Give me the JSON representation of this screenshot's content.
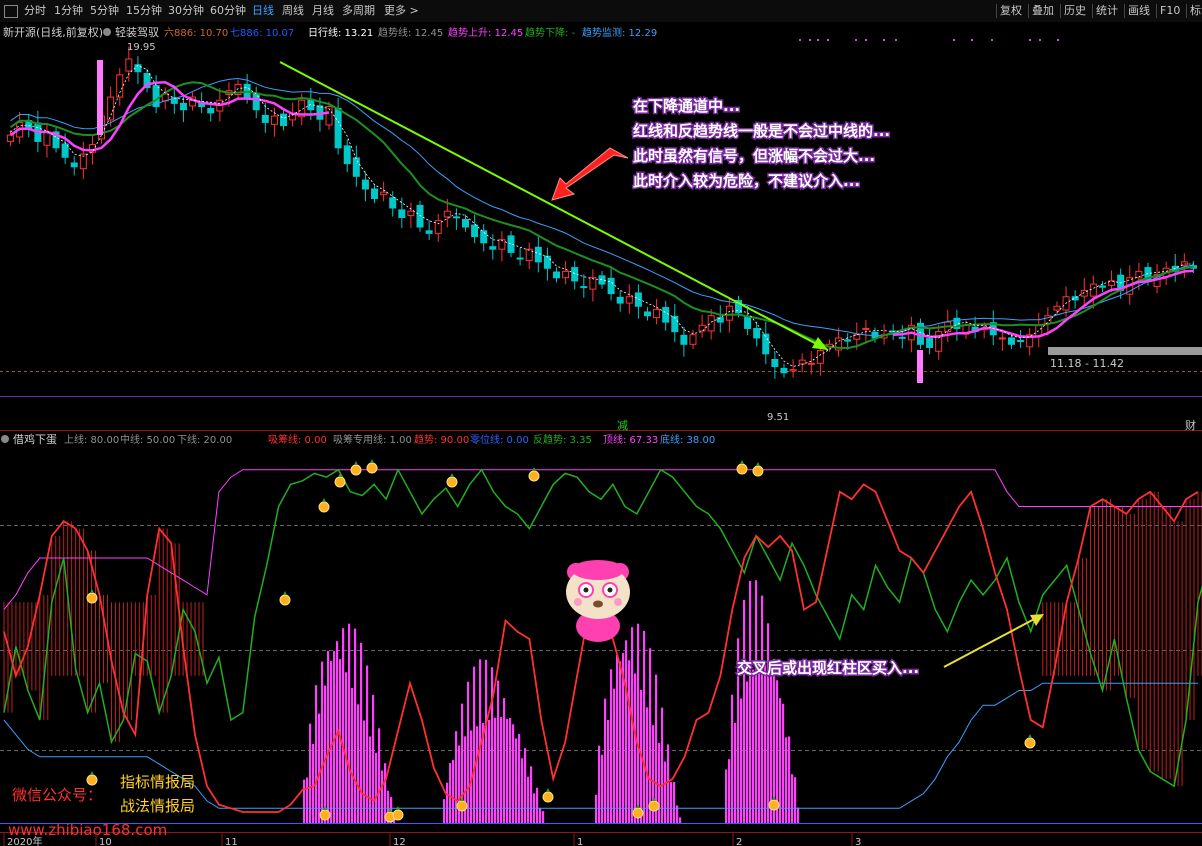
{
  "toolbar": {
    "periods": [
      "分时",
      "1分钟",
      "5分钟",
      "15分钟",
      "30分钟",
      "60分钟",
      "日线",
      "周线",
      "月线",
      "多周期",
      "更多"
    ],
    "active_period": "日线",
    "right_buttons": [
      "复权",
      "叠加",
      "历史",
      "统计",
      "画线",
      "F10",
      "标记"
    ]
  },
  "main_panel": {
    "stock_title": "新开源(日线,前复权)",
    "indicator_name": "轻装驾驭",
    "legend": [
      {
        "label": "六886: 10.70",
        "color": "#d2691e"
      },
      {
        "label": "七886: 10.07",
        "color": "#1e5aff"
      },
      {
        "label": "日行线: 13.21",
        "color": "#ffffff"
      },
      {
        "label": "趋势线: 12.45",
        "color": "#909090"
      },
      {
        "label": "趋势上升: 12.45",
        "color": "#ff40ff"
      },
      {
        "label": "趋势下降: -",
        "color": "#20b020"
      },
      {
        "label": "趋势监测: 12.29",
        "color": "#3aa0ff"
      }
    ],
    "high_label": "19.95",
    "low_label": "9.51",
    "price_tag": "11.18 - 11.42",
    "signal_label": "减",
    "right_edge_label": "财",
    "annotation_lines": [
      "在下降通道中...",
      "红线和反趋势线一般是不会过中线的...",
      "此时虽然有信号，但涨幅不会过大...",
      "此时介入较为危险，不建议介入..."
    ]
  },
  "sub_panel": {
    "indicator_name": "借鸡下蛋",
    "legend": [
      {
        "label": "上线: 80.00",
        "color": "#909090"
      },
      {
        "label": "中线: 50.00",
        "color": "#909090"
      },
      {
        "label": "下线: 20.00",
        "color": "#909090"
      },
      {
        "label": "吸筹线: 0.00",
        "color": "#ff3030"
      },
      {
        "label": "吸筹专用线: 1.00",
        "color": "#909090"
      },
      {
        "label": "趋势: 90.00",
        "color": "#ff3030"
      },
      {
        "label": "零位线: 0.00",
        "color": "#3060ff"
      },
      {
        "label": "反趋势: 3.35",
        "color": "#20b020"
      },
      {
        "label": "顶线: 67.33",
        "color": "#ff40ff"
      },
      {
        "label": "底线: 38.00",
        "color": "#3aa0ff"
      }
    ],
    "annotation": "交叉后或出现红柱区买入..."
  },
  "watermark": {
    "wechat_label": "微信公众号：",
    "line1": "指标情报局",
    "line2": "战法情报局",
    "url": "www.zhibiao168.com"
  },
  "time_axis": [
    "2020年",
    "10",
    "11",
    "12",
    "1",
    "2",
    "3"
  ],
  "colors": {
    "up": "#ff3232",
    "down": "#00c8c8",
    "ma_white": "#e0e0e0",
    "ma_magenta": "#ff40ff",
    "ma_green": "#1f8f1f",
    "ma_blue": "#3aa0ff",
    "trendline": "#7cfc00",
    "arrow_red": "#ff2020",
    "annotation_text": "#ffffff",
    "annotation_bg": "#000000"
  },
  "chart_data": [
    {
      "type": "candlestick",
      "title": "新开源(日线,前复权)",
      "x_labels": [
        "2020年",
        "10",
        "11",
        "12",
        "1",
        "2",
        "3"
      ],
      "ylim": [
        9.0,
        20.2
      ],
      "high": 19.95,
      "low": 9.51,
      "close_series": [
        17.2,
        17.6,
        17.4,
        17.0,
        17.3,
        16.8,
        16.5,
        16.2,
        16.6,
        16.9,
        17.8,
        18.4,
        19.1,
        19.6,
        19.2,
        18.7,
        18.1,
        18.5,
        18.2,
        18.0,
        18.4,
        18.1,
        17.9,
        18.3,
        18.6,
        18.8,
        18.4,
        18.0,
        17.6,
        17.8,
        17.5,
        17.9,
        18.3,
        18.0,
        17.7,
        18.1,
        16.8,
        16.3,
        15.9,
        15.5,
        15.2,
        15.4,
        14.9,
        14.6,
        14.8,
        14.3,
        14.1,
        14.5,
        14.8,
        14.6,
        14.3,
        14.0,
        13.8,
        13.6,
        13.9,
        13.5,
        13.3,
        13.6,
        13.2,
        13.0,
        12.7,
        12.9,
        12.6,
        12.4,
        12.7,
        12.5,
        12.2,
        11.9,
        12.1,
        11.8,
        11.5,
        11.7,
        11.3,
        11.0,
        10.6,
        10.9,
        11.2,
        11.5,
        11.3,
        11.8,
        11.6,
        11.1,
        10.8,
        10.3,
        9.9,
        9.7,
        9.8,
        10.1,
        10.0,
        10.4,
        10.6,
        10.8,
        10.7,
        10.9,
        11.1,
        10.8,
        10.9,
        11.0,
        10.8,
        11.2,
        10.6,
        10.5,
        11.0,
        11.3,
        11.1,
        11.2,
        11.0,
        11.1,
        10.9,
        10.8,
        10.6,
        10.7,
        10.9,
        11.2,
        11.5,
        11.8,
        12.1,
        12.0,
        12.3,
        12.5,
        12.4,
        12.6,
        12.3,
        12.7,
        12.9,
        12.6,
        12.8,
        13.0,
        12.9,
        13.2,
        13.0
      ]
    },
    {
      "type": "line",
      "title": "借鸡下蛋",
      "ylim": [
        0,
        100
      ],
      "reference_lines": [
        80,
        50,
        20
      ],
      "series": [
        {
          "name": "趋势",
          "color": "#ff3030",
          "values": [
            52,
            40,
            48,
            62,
            78,
            82,
            80,
            74,
            62,
            44,
            30,
            24,
            62,
            80,
            76,
            48,
            24,
            10,
            5,
            4,
            3,
            3,
            3,
            3,
            5,
            9,
            10,
            18,
            25,
            14,
            8,
            6,
            12,
            25,
            38,
            28,
            15,
            8,
            6,
            10,
            22,
            35,
            55,
            52,
            50,
            28,
            12,
            22,
            40,
            58,
            55,
            50,
            38,
            22,
            12,
            10,
            12,
            18,
            28,
            30,
            40,
            58,
            72,
            78,
            75,
            78,
            74,
            58,
            60,
            75,
            90,
            88,
            92,
            90,
            82,
            74,
            72,
            68,
            74,
            80,
            86,
            90,
            80,
            68,
            58,
            42,
            28,
            26,
            42,
            60,
            72,
            86,
            88,
            86,
            84,
            88,
            90,
            86,
            82,
            88,
            90
          ]
        },
        {
          "name": "反趋势",
          "color": "#20b020",
          "values": [
            30,
            48,
            36,
            28,
            60,
            72,
            42,
            30,
            38,
            22,
            28,
            46,
            44,
            30,
            40,
            58,
            52,
            38,
            45,
            28,
            30,
            56,
            70,
            86,
            92,
            93,
            95,
            94,
            96,
            90,
            89,
            92,
            88,
            96,
            90,
            84,
            88,
            91,
            86,
            92,
            96,
            90,
            86,
            84,
            80,
            86,
            92,
            95,
            94,
            90,
            88,
            92,
            86,
            84,
            90,
            96,
            94,
            90,
            86,
            84,
            80,
            74,
            68,
            78,
            72,
            66,
            76,
            70,
            62,
            56,
            50,
            62,
            58,
            70,
            64,
            60,
            72,
            68,
            58,
            52,
            60,
            66,
            62,
            66,
            72,
            60,
            52,
            62,
            66,
            70,
            58,
            46,
            36,
            50,
            34,
            20,
            14,
            12,
            10,
            28,
            60,
            72
          ]
        },
        {
          "name": "顶线",
          "color": "#ff40ff",
          "values": [
            58,
            62,
            68,
            72,
            72,
            72,
            72,
            72,
            72,
            72,
            72,
            72,
            72,
            70,
            68,
            66,
            64,
            62,
            90,
            94,
            96,
            96,
            96,
            96,
            96,
            96,
            96,
            96,
            96,
            96,
            96,
            96,
            96,
            96,
            96,
            96,
            96,
            96,
            96,
            96,
            96,
            96,
            96,
            96,
            96,
            96,
            96,
            96,
            96,
            96,
            96,
            96,
            96,
            96,
            96,
            96,
            96,
            96,
            96,
            96,
            96,
            96,
            96,
            96,
            96,
            96,
            96,
            96,
            96,
            96,
            96,
            96,
            96,
            96,
            96,
            96,
            96,
            96,
            96,
            96,
            96,
            96,
            96,
            96,
            90,
            86,
            86,
            86,
            86,
            86,
            86,
            86,
            86,
            86,
            86,
            86,
            86,
            86,
            86,
            86,
            86,
            86,
            86
          ]
        },
        {
          "name": "底线",
          "color": "#3aa0ff",
          "values": [
            28,
            24,
            20,
            18,
            18,
            18,
            18,
            18,
            18,
            18,
            18,
            18,
            18,
            16,
            14,
            12,
            10,
            6,
            4,
            4,
            4,
            4,
            4,
            4,
            4,
            4,
            4,
            4,
            4,
            4,
            4,
            4,
            4,
            4,
            4,
            4,
            4,
            4,
            4,
            4,
            4,
            4,
            4,
            4,
            4,
            4,
            4,
            4,
            4,
            4,
            4,
            4,
            4,
            4,
            4,
            4,
            4,
            4,
            4,
            4,
            4,
            4,
            4,
            4,
            4,
            4,
            4,
            4,
            4,
            4,
            4,
            4,
            4,
            4,
            4,
            4,
            6,
            8,
            12,
            18,
            22,
            28,
            32,
            32,
            34,
            36,
            36,
            38,
            38,
            38,
            38,
            38,
            38,
            38,
            38,
            38,
            38,
            38,
            38,
            38,
            38
          ]
        }
      ]
    }
  ]
}
